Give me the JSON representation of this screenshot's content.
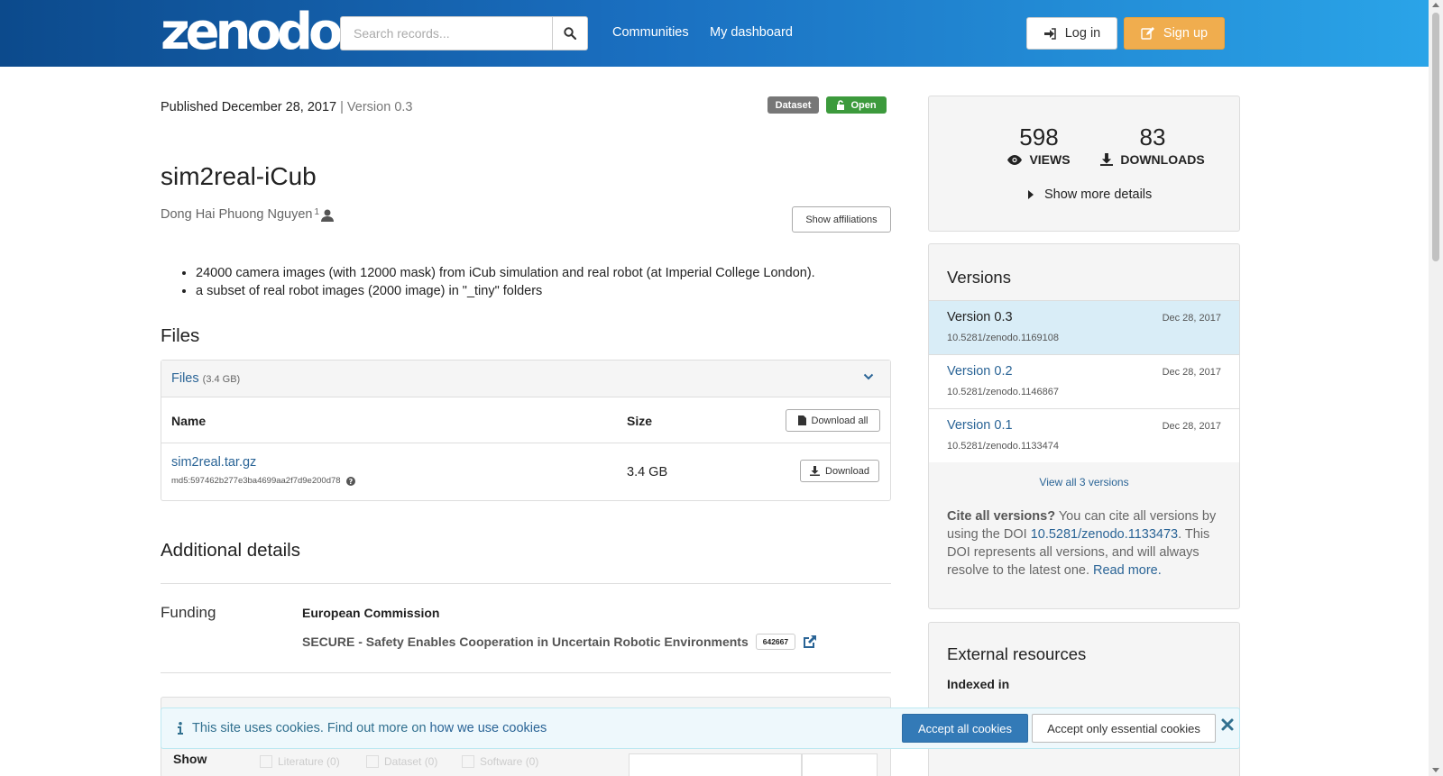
{
  "header": {
    "logo": "zenodo",
    "search_placeholder": "Search records...",
    "nav": [
      "Communities",
      "My dashboard"
    ],
    "login_label": "Log in",
    "signup_label": "Sign up"
  },
  "record": {
    "published": "Published December 28, 2017",
    "version_sep": "|",
    "version": "Version 0.3",
    "badge_type": "Dataset",
    "badge_access": "Open",
    "title": "sim2real-iCub",
    "author": "Dong Hai Phuong Nguyen",
    "author_affil_marker": "1",
    "show_affiliations": "Show affiliations",
    "description": [
      "24000 camera images (with 12000 mask) from iCub simulation and real robot (at Imperial College London).",
      "a subset of real robot images (2000 image) in \"_tiny\" folders"
    ]
  },
  "files": {
    "heading": "Files",
    "panel_label": "Files",
    "panel_size": "(3.4 GB)",
    "col_name": "Name",
    "col_size": "Size",
    "download_all": "Download all",
    "items": [
      {
        "name": "sim2real.tar.gz",
        "md5": "md5:597462b277e3ba4699aa2f7d9e200d78",
        "size": "3.4 GB",
        "download": "Download"
      }
    ]
  },
  "additional": {
    "heading": "Additional details",
    "funding_label": "Funding",
    "funder": "European Commission",
    "grant_title": "SECURE - Safety Enables Cooperation in Uncertain Robotic Environments",
    "grant_number": "642667",
    "show_label": "Show",
    "filter_options": [
      "Literature (0)",
      "Dataset (0)",
      "Software (0)"
    ]
  },
  "stats": {
    "views": "598",
    "views_label": "VIEWS",
    "downloads": "83",
    "downloads_label": "DOWNLOADS",
    "more_details": "Show more details"
  },
  "versions": {
    "title": "Versions",
    "items": [
      {
        "name": "Version 0.3",
        "date": "Dec 28, 2017",
        "doi": "10.5281/zenodo.1169108",
        "active": true
      },
      {
        "name": "Version 0.2",
        "date": "Dec 28, 2017",
        "doi": "10.5281/zenodo.1146867",
        "active": false
      },
      {
        "name": "Version 0.1",
        "date": "Dec 28, 2017",
        "doi": "10.5281/zenodo.1133474",
        "active": false
      }
    ],
    "view_all": "View all 3 versions",
    "cite_bold": "Cite all versions?",
    "cite_text1": " You can cite all versions by using the DOI ",
    "cite_doi": "10.5281/zenodo.1133473",
    "cite_text2": ". This DOI represents all versions, and will always resolve to the latest one. ",
    "read_more": "Read more."
  },
  "external": {
    "title": "External resources",
    "indexed_in": "Indexed in"
  },
  "cookies": {
    "text": "This site uses cookies. Find out more on ",
    "link": "how we use cookies",
    "accept_all": "Accept all cookies",
    "accept_essential": "Accept only essential cookies"
  },
  "colors": {
    "header_start": "#0c4a8c",
    "header_end": "#2aa4e8",
    "signup": "#f0ad4e",
    "open_badge": "#3c9a3c",
    "link": "#2a6496",
    "accept_button": "#337ab7"
  },
  "icons": [
    "search-icon",
    "sign-in-icon",
    "edit-icon",
    "unlock-icon",
    "user-icon",
    "chevron-down-icon",
    "file-icon",
    "download-icon",
    "question-icon",
    "external-link-icon",
    "eye-icon",
    "caret-right-icon",
    "info-icon",
    "close-icon"
  ]
}
